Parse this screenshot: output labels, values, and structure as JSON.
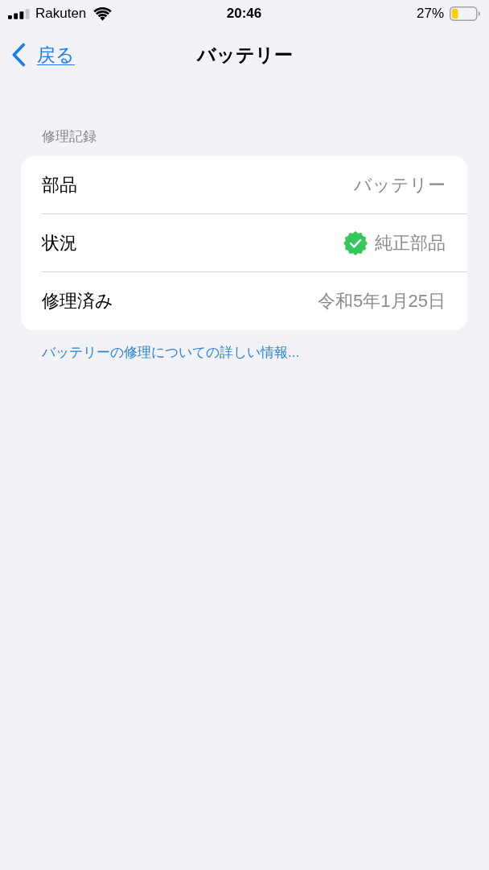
{
  "status_bar": {
    "carrier": "Rakuten",
    "time": "20:46",
    "battery_percent": "27%"
  },
  "nav": {
    "back_label": "戻る",
    "title": "バッテリー"
  },
  "repair_record": {
    "header": "修理記録",
    "rows": [
      {
        "kind": "text",
        "label": "部品",
        "value": "バッテリー"
      },
      {
        "kind": "verified",
        "label": "状況",
        "value": "純正部品"
      },
      {
        "kind": "text",
        "label": "修理済み",
        "value": "令和5年1月25日"
      }
    ]
  },
  "footer_link": "バッテリーの修理についての詳しい情報..."
}
